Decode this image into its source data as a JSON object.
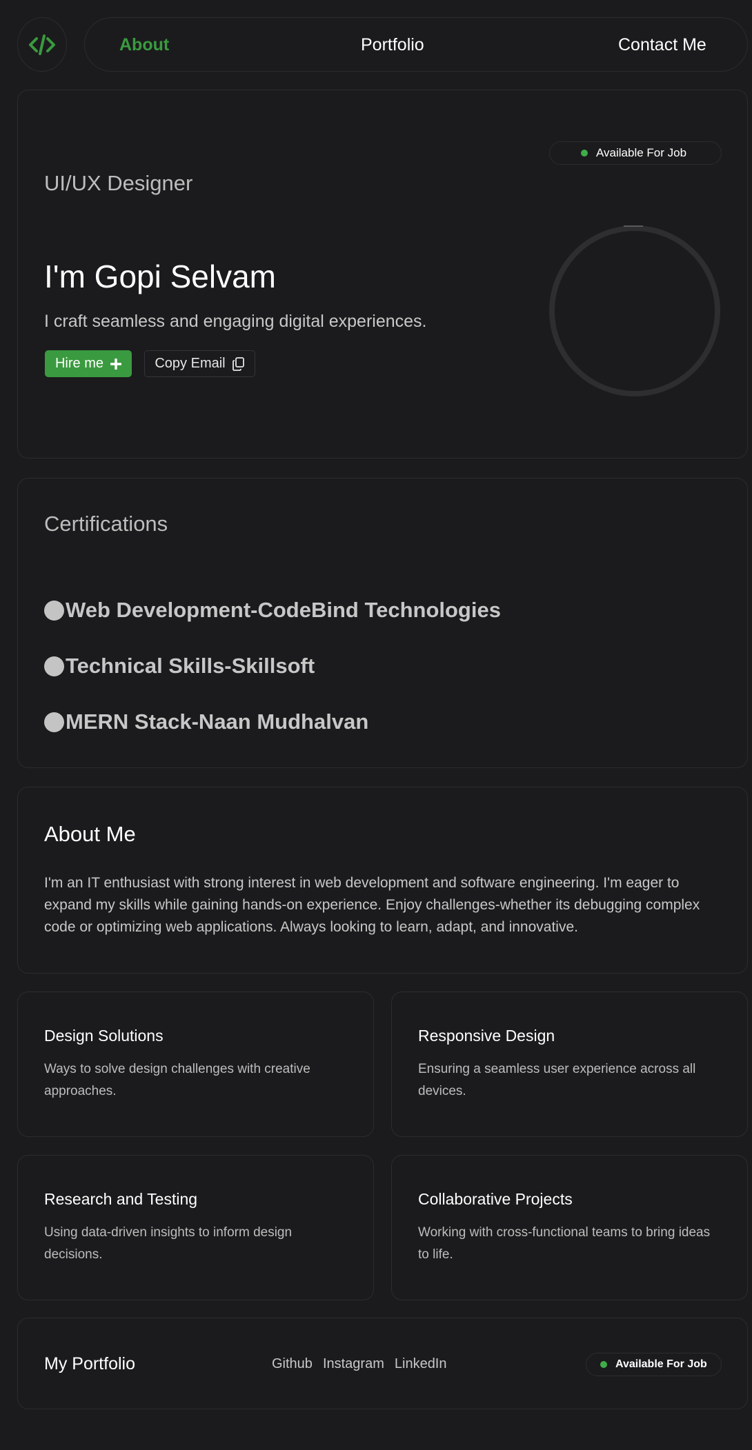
{
  "nav": {
    "logo_icon": "code-icon",
    "links": [
      {
        "label": "About",
        "active": true
      },
      {
        "label": "Portfolio",
        "active": false
      },
      {
        "label": "Contact Me",
        "active": false
      }
    ]
  },
  "hero": {
    "badge": "Available For Job",
    "role": "UI/UX Designer",
    "name": "I'm Gopi Selvam",
    "tagline": "I craft seamless and engaging digital experiences.",
    "hire_label": "Hire me",
    "copy_label": "Copy Email"
  },
  "certifications": {
    "title": "Certifications",
    "items": [
      "Web Development-CodeBind Technologies",
      "Technical Skills-Skillsoft",
      "MERN Stack-Naan Mudhalvan"
    ]
  },
  "about": {
    "title": "About Me",
    "text": "I'm an IT enthusiast with strong interest in web development and software engineering. I'm eager to expand my skills while gaining hands-on experience. Enjoy challenges-whether its debugging complex code or optimizing web applications. Always looking to learn, adapt, and innovative."
  },
  "services": [
    {
      "title": "Design Solutions",
      "text": "Ways to solve design challenges with creative approaches."
    },
    {
      "title": "Responsive Design",
      "text": "Ensuring a seamless user experience across all devices."
    },
    {
      "title": "Research and Testing",
      "text": "Using data-driven insights to inform design decisions."
    },
    {
      "title": "Collaborative Projects",
      "text": "Working with cross-functional teams to bring ideas to life."
    }
  ],
  "footer": {
    "title": "My Portfolio",
    "links": [
      "Github",
      "Instagram",
      "LinkedIn"
    ],
    "badge": "Available For Job"
  },
  "colors": {
    "background": "#1b1b1d",
    "accent": "#3a9a3f",
    "status_dot": "#3fae49",
    "border": "#2c2c2f"
  }
}
